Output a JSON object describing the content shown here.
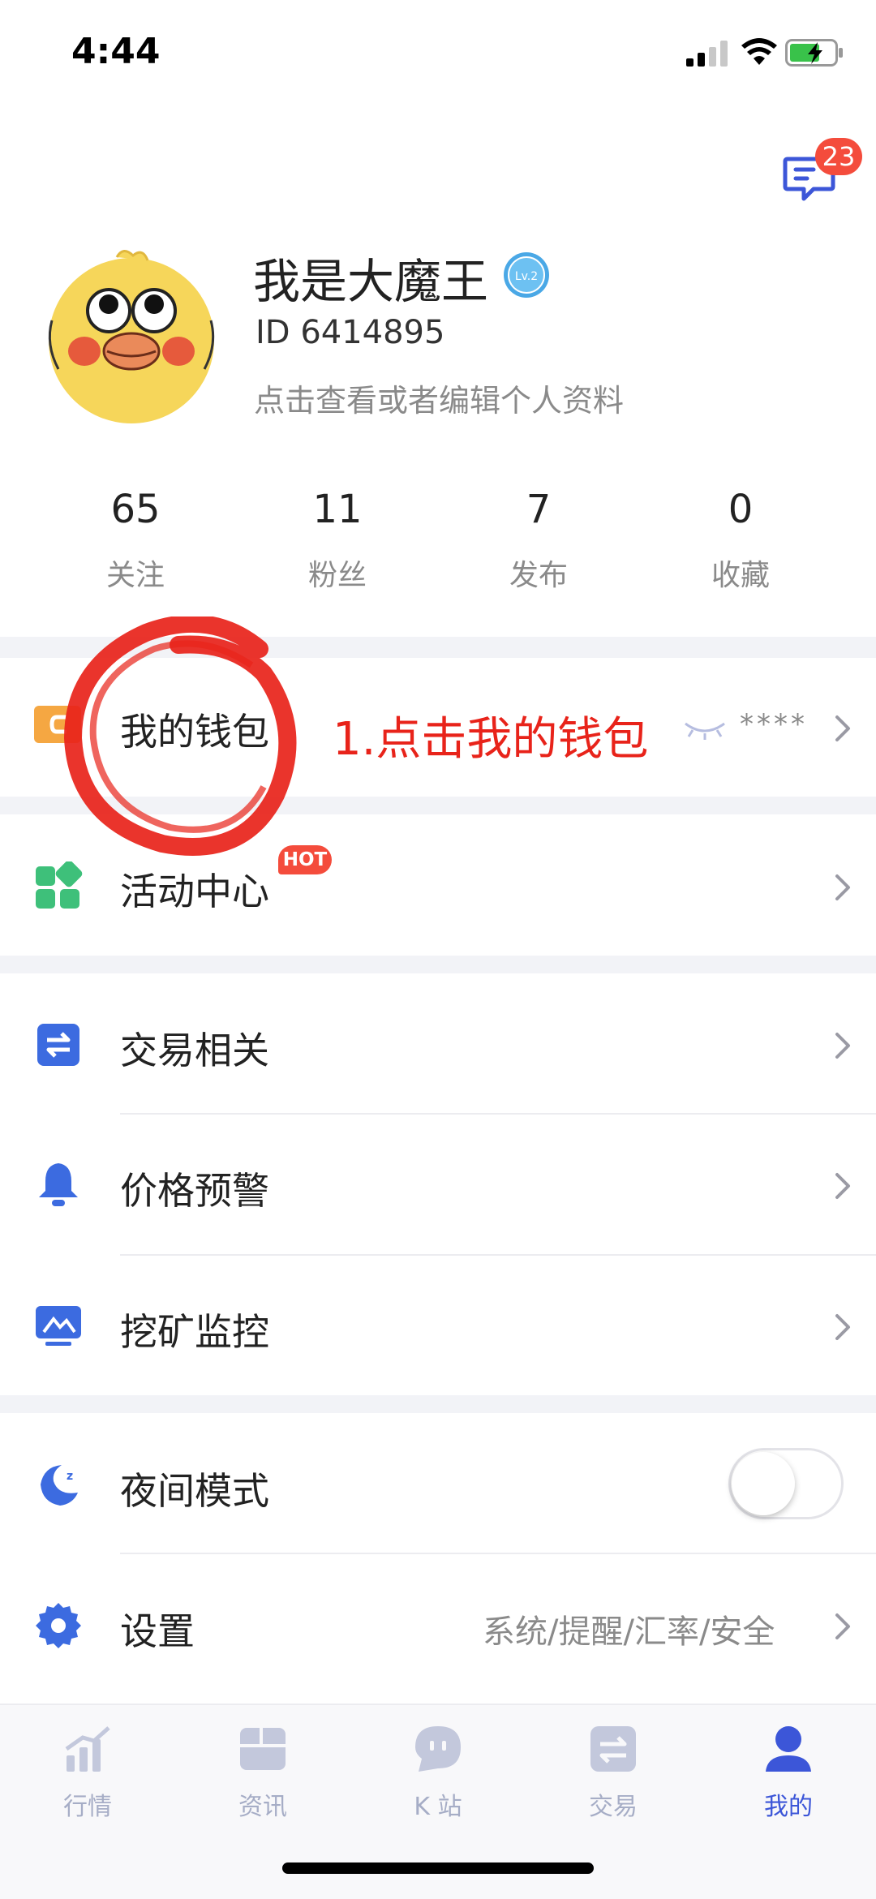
{
  "status_bar": {
    "time": "4:44"
  },
  "header": {
    "message_badge": "23"
  },
  "profile": {
    "name": "我是大魔王",
    "level": "Lv.2",
    "id": "ID 6414895",
    "edit_hint": "点击查看或者编辑个人资料"
  },
  "stats": [
    {
      "value": "65",
      "label": "关注"
    },
    {
      "value": "11",
      "label": "粉丝"
    },
    {
      "value": "7",
      "label": "发布"
    },
    {
      "value": "0",
      "label": "收藏"
    }
  ],
  "menu": {
    "wallet": {
      "label": "我的钱包",
      "masked_balance": "****"
    },
    "annotation": "1.点击我的钱包",
    "activity": {
      "label": "活动中心",
      "badge": "HOT"
    },
    "trade": {
      "label": "交易相关"
    },
    "price_alert": {
      "label": "价格预警"
    },
    "mining": {
      "label": "挖矿监控"
    },
    "night_mode": {
      "label": "夜间模式",
      "enabled": false
    },
    "settings": {
      "label": "设置",
      "desc": "系统/提醒/汇率/安全"
    }
  },
  "tabs": [
    {
      "label": "行情",
      "icon": "chart-icon",
      "active": false
    },
    {
      "label": "资讯",
      "icon": "news-icon",
      "active": false
    },
    {
      "label": "K 站",
      "icon": "kstation-icon",
      "active": false
    },
    {
      "label": "交易",
      "icon": "trade-icon",
      "active": false
    },
    {
      "label": "我的",
      "icon": "profile-icon",
      "active": true
    }
  ],
  "colors": {
    "accent": "#3c56d8",
    "badge": "#f44c3c",
    "annotation": "#e8231a",
    "wallet_icon": "#f5a742",
    "activity_icon": "#3ec07a"
  }
}
